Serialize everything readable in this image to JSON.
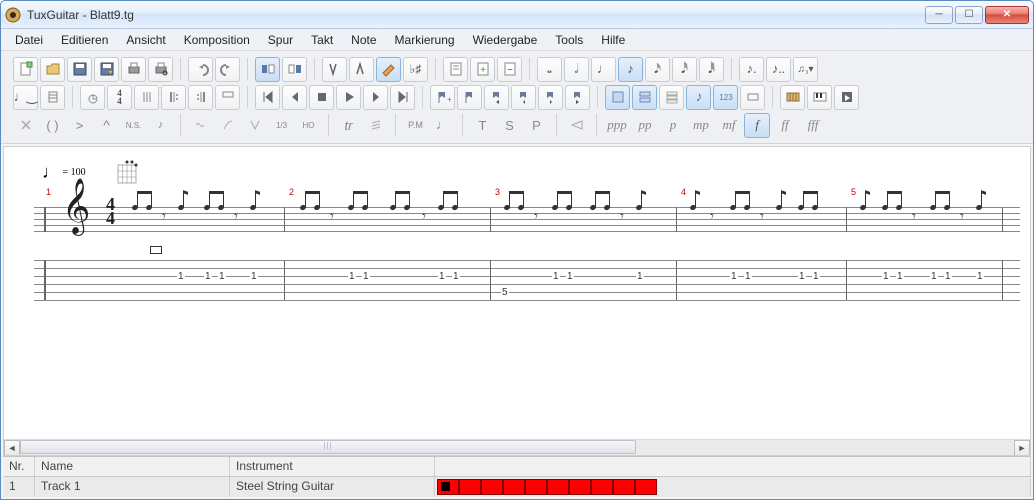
{
  "app": {
    "title": "TuxGuitar - Blatt9.tg"
  },
  "menu": {
    "items": [
      "Datei",
      "Editieren",
      "Ansicht",
      "Komposition",
      "Spur",
      "Takt",
      "Note",
      "Markierung",
      "Wiedergabe",
      "Tools",
      "Hilfe"
    ]
  },
  "tempo": {
    "bpm": "= 100"
  },
  "timesig": {
    "num": "4",
    "den": "4"
  },
  "track_header": {
    "nr": "Nr.",
    "name": "Name",
    "instrument": "Instrument"
  },
  "track": {
    "nr": "1",
    "name": "Track 1",
    "instrument": "Steel String Guitar"
  },
  "measures": {
    "m1": "1",
    "m2": "2",
    "m3": "3",
    "m4": "4",
    "m5": "5"
  },
  "tab": {
    "pattern": [
      "1",
      "1",
      "1",
      "1"
    ],
    "special": "5"
  },
  "dynamics": {
    "ppp": "ppp",
    "pp": "pp",
    "p": "p",
    "mp": "mp",
    "mf": "mf",
    "f": "f",
    "ff": "ff",
    "fff": "fff"
  },
  "symbols": {
    "parens": "( )",
    "gt": ">",
    "ns": "N.S.",
    "onethird": "1/3",
    "ho": "HO",
    "tr": "tr",
    "pm": "P.M",
    "t": "T",
    "s": "S",
    "p2": "P"
  }
}
